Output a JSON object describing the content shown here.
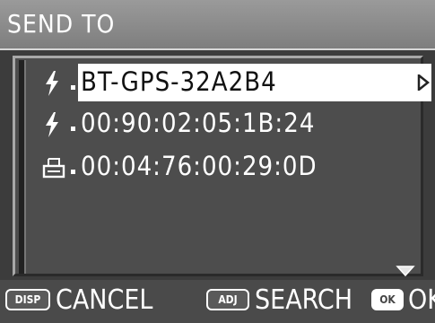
{
  "title": "SEND TO",
  "devices": [
    {
      "icon": "bluetooth-icon",
      "label": "BT-GPS-32A2B4",
      "selected": true
    },
    {
      "icon": "bluetooth-icon",
      "label": "00:90:02:05:1B:24",
      "selected": false
    },
    {
      "icon": "printer-icon",
      "label": "00:04:76:00:29:0D",
      "selected": false
    }
  ],
  "footer": {
    "disp_badge": "DISP",
    "cancel_label": "CANCEL",
    "adj_badge": "ADJ",
    "search_label": "SEARCH",
    "ok_badge": "OK",
    "ok_label": "OK"
  }
}
